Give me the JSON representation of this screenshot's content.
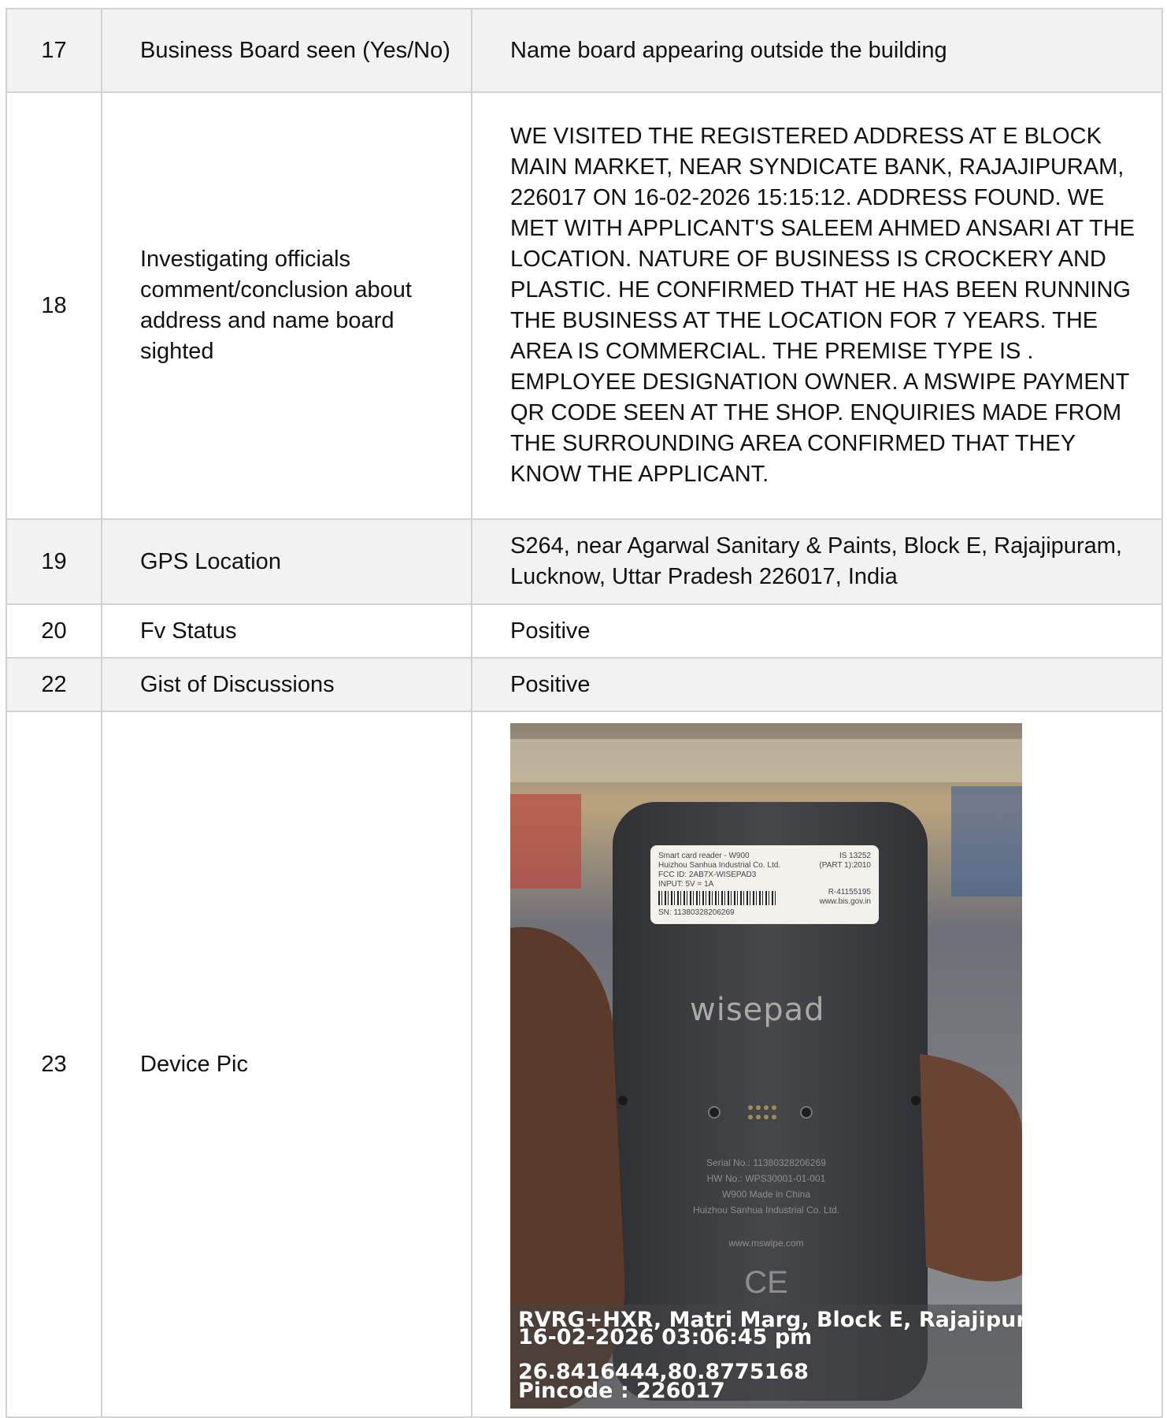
{
  "rows": [
    {
      "no": "17",
      "label": "Business Board seen (Yes/No)",
      "value": "Name board appearing outside the building"
    },
    {
      "no": "18",
      "label": "Investigating officials comment/conclusion about address and name board sighted",
      "value": "WE VISITED THE REGISTERED ADDRESS AT E BLOCK MAIN MARKET, NEAR SYNDICATE BANK, RAJAJIPURAM, 226017 ON 16-02-2026 15:15:12. ADDRESS FOUND. WE MET WITH APPLICANT'S SALEEM AHMED ANSARI AT THE LOCATION. NATURE OF BUSINESS IS CROCKERY AND PLASTIC. HE CONFIRMED THAT HE HAS BEEN RUNNING THE BUSINESS AT THE LOCATION FOR 7 YEARS. THE AREA IS COMMERCIAL. THE PREMISE TYPE IS . EMPLOYEE DESIGNATION OWNER. A MSWIPE PAYMENT QR CODE SEEN AT THE SHOP. ENQUIRIES MADE FROM THE SURROUNDING AREA CONFIRMED THAT THEY KNOW THE APPLICANT."
    },
    {
      "no": "19",
      "label": "GPS Location",
      "value": "S264, near Agarwal Sanitary & Paints, Block E, Rajajipuram, Lucknow, Uttar Pradesh 226017, India"
    },
    {
      "no": "20",
      "label": "Fv Status",
      "value": "Positive"
    },
    {
      "no": "22",
      "label": "Gist of Discussions",
      "value": "Positive"
    },
    {
      "no": "23",
      "label": "Device Pic",
      "value": ""
    }
  ],
  "photo": {
    "overlay_lines": [
      "RVRG+HXR, Matri Marg, Block E, Rajajipuram",
      "16-02-2026 03:06:45 pm",
      "26.8416444,80.8775168",
      "Pincode : 226017"
    ],
    "sticker_lines": [
      "Smart card reader - W900",
      "Huizhou Sanhua Industrial Co. Ltd.",
      "FCC ID: 2AB7X-WISEPAD3",
      "INPUT: 5V = 1A",
      "SN: 11380328206269",
      "IS 13252",
      "(PART 1):2010",
      "R-41155195",
      "www.bis.gov.in"
    ],
    "brand": "wisepad",
    "device_lines": [
      "Serial No.: 11380328206269",
      "HW No.: WPS30001-01-001",
      "W900 Made in China",
      "Huizhou Sanhua Industrial Co. Ltd.",
      "www.mswipe.com"
    ],
    "ce_mark": "CE"
  },
  "colors": {
    "border": "#d2d2d2",
    "shade": "#f2f2f2",
    "device": "#3b3d40"
  }
}
